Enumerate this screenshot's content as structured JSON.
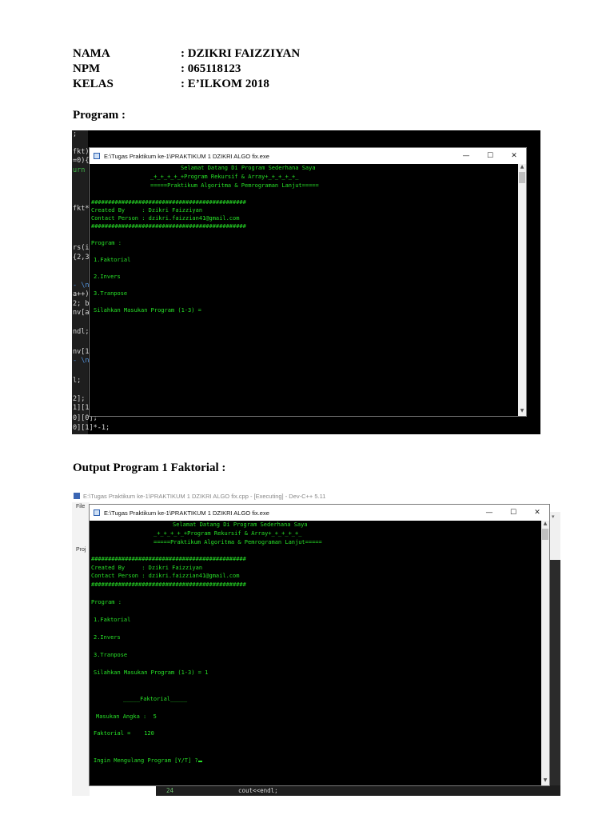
{
  "info": {
    "nama_label": "NAMA",
    "nama_value": ": DZIKRI FAIZZIYAN",
    "npm_label": "NPM",
    "npm_value": ": 065118123",
    "kelas_label": "KELAS",
    "kelas_value": ": E’ILKOM 2018"
  },
  "headings": {
    "program": "Program :",
    "output": "Output Program 1 Faktorial :"
  },
  "screenshot1": {
    "code_fragments": [
      ";",
      "fkt)",
      "=0){",
      "urn",
      "fkt*",
      "rs(i",
      "{2,3",
      "- \\n",
      "a++)",
      "2; b",
      "nv[a",
      "ndl;",
      "nv[1",
      "- \\n",
      "l;",
      "2];",
      "1][1",
      "0][0];",
      "0][1]*-1;"
    ],
    "window_title": "E:\\Tugas Praktikum ke-1\\PRAKTIKUM 1 DZIKRI ALGO fix.exe",
    "minimize": "—",
    "maximize": "☐",
    "close": "✕",
    "terminal": {
      "welcome": "Selamat Datang Di Program Sederhana Saya",
      "subtitle1": "_+_+_+_+_+Program Rekursif & Array+_+_+_+_+_",
      "subtitle2": "=====Praktikum Algoritma & Pemrograman Lanjut=====",
      "hash_line": "##############################################",
      "created": "Created By     : Dzikri Faizziyan",
      "contact": "Contact Person : dzikri.faizzian41@gmail.com",
      "program": "Program :",
      "opt1": "1.Faktorial",
      "opt2": "2.Invers",
      "opt3": "3.Tranpose",
      "prompt": "Silahkan Masukan Program (1-3) ="
    }
  },
  "screenshot2": {
    "devcpp_title": "E:\\Tugas Praktikum ke-1\\PRAKTIKUM 1 DZIKRI ALGO fix.cpp - [Executing] - Dev-C++ 5.11",
    "side_file": "File",
    "side_proj": "Proj",
    "window_title": "E:\\Tugas Praktikum ke-1\\PRAKTIKUM 1 DZIKRI ALGO fix.exe",
    "minimize": "—",
    "maximize": "☐",
    "close": "✕",
    "line_number": "24",
    "code_line": "cout<<endl;",
    "terminal": {
      "welcome": "Selamat Datang Di Program Sederhana Saya",
      "subtitle1": "_+_+_+_+_+Program Rekursif & Array+_+_+_+_+_",
      "subtitle2": "=====Praktikum Algoritma & Pemrograman Lanjut=====",
      "hash_line": "##############################################",
      "created": "Created By     : Dzikri Faizziyan",
      "contact": "Contact Person : dzikri.faizzian41@gmail.com",
      "program": "Program :",
      "opt1": "1.Faktorial",
      "opt2": "2.Invers",
      "opt3": "3.Tranpose",
      "prompt": "Silahkan Masukan Program (1-3) = 1",
      "faktorial_header": "_____Faktorial_____",
      "masukan": "Masukan Angka :  5",
      "hasil": "Faktorial =    120",
      "ulang": "Ingin Mengulang Program [Y/T] ?"
    }
  }
}
